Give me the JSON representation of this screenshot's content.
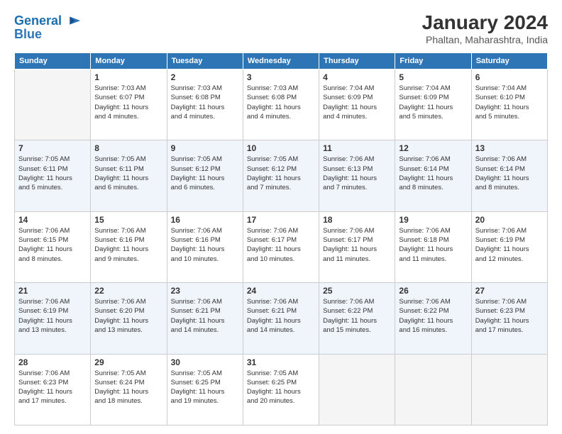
{
  "logo": {
    "line1": "General",
    "line2": "Blue"
  },
  "header": {
    "month": "January 2024",
    "location": "Phaltan, Maharashtra, India"
  },
  "weekdays": [
    "Sunday",
    "Monday",
    "Tuesday",
    "Wednesday",
    "Thursday",
    "Friday",
    "Saturday"
  ],
  "weeks": [
    [
      {
        "day": "",
        "info": ""
      },
      {
        "day": "1",
        "info": "Sunrise: 7:03 AM\nSunset: 6:07 PM\nDaylight: 11 hours\nand 4 minutes."
      },
      {
        "day": "2",
        "info": "Sunrise: 7:03 AM\nSunset: 6:08 PM\nDaylight: 11 hours\nand 4 minutes."
      },
      {
        "day": "3",
        "info": "Sunrise: 7:03 AM\nSunset: 6:08 PM\nDaylight: 11 hours\nand 4 minutes."
      },
      {
        "day": "4",
        "info": "Sunrise: 7:04 AM\nSunset: 6:09 PM\nDaylight: 11 hours\nand 4 minutes."
      },
      {
        "day": "5",
        "info": "Sunrise: 7:04 AM\nSunset: 6:09 PM\nDaylight: 11 hours\nand 5 minutes."
      },
      {
        "day": "6",
        "info": "Sunrise: 7:04 AM\nSunset: 6:10 PM\nDaylight: 11 hours\nand 5 minutes."
      }
    ],
    [
      {
        "day": "7",
        "info": "Sunrise: 7:05 AM\nSunset: 6:11 PM\nDaylight: 11 hours\nand 5 minutes."
      },
      {
        "day": "8",
        "info": "Sunrise: 7:05 AM\nSunset: 6:11 PM\nDaylight: 11 hours\nand 6 minutes."
      },
      {
        "day": "9",
        "info": "Sunrise: 7:05 AM\nSunset: 6:12 PM\nDaylight: 11 hours\nand 6 minutes."
      },
      {
        "day": "10",
        "info": "Sunrise: 7:05 AM\nSunset: 6:12 PM\nDaylight: 11 hours\nand 7 minutes."
      },
      {
        "day": "11",
        "info": "Sunrise: 7:06 AM\nSunset: 6:13 PM\nDaylight: 11 hours\nand 7 minutes."
      },
      {
        "day": "12",
        "info": "Sunrise: 7:06 AM\nSunset: 6:14 PM\nDaylight: 11 hours\nand 8 minutes."
      },
      {
        "day": "13",
        "info": "Sunrise: 7:06 AM\nSunset: 6:14 PM\nDaylight: 11 hours\nand 8 minutes."
      }
    ],
    [
      {
        "day": "14",
        "info": "Sunrise: 7:06 AM\nSunset: 6:15 PM\nDaylight: 11 hours\nand 8 minutes."
      },
      {
        "day": "15",
        "info": "Sunrise: 7:06 AM\nSunset: 6:16 PM\nDaylight: 11 hours\nand 9 minutes."
      },
      {
        "day": "16",
        "info": "Sunrise: 7:06 AM\nSunset: 6:16 PM\nDaylight: 11 hours\nand 10 minutes."
      },
      {
        "day": "17",
        "info": "Sunrise: 7:06 AM\nSunset: 6:17 PM\nDaylight: 11 hours\nand 10 minutes."
      },
      {
        "day": "18",
        "info": "Sunrise: 7:06 AM\nSunset: 6:17 PM\nDaylight: 11 hours\nand 11 minutes."
      },
      {
        "day": "19",
        "info": "Sunrise: 7:06 AM\nSunset: 6:18 PM\nDaylight: 11 hours\nand 11 minutes."
      },
      {
        "day": "20",
        "info": "Sunrise: 7:06 AM\nSunset: 6:19 PM\nDaylight: 11 hours\nand 12 minutes."
      }
    ],
    [
      {
        "day": "21",
        "info": "Sunrise: 7:06 AM\nSunset: 6:19 PM\nDaylight: 11 hours\nand 13 minutes."
      },
      {
        "day": "22",
        "info": "Sunrise: 7:06 AM\nSunset: 6:20 PM\nDaylight: 11 hours\nand 13 minutes."
      },
      {
        "day": "23",
        "info": "Sunrise: 7:06 AM\nSunset: 6:21 PM\nDaylight: 11 hours\nand 14 minutes."
      },
      {
        "day": "24",
        "info": "Sunrise: 7:06 AM\nSunset: 6:21 PM\nDaylight: 11 hours\nand 14 minutes."
      },
      {
        "day": "25",
        "info": "Sunrise: 7:06 AM\nSunset: 6:22 PM\nDaylight: 11 hours\nand 15 minutes."
      },
      {
        "day": "26",
        "info": "Sunrise: 7:06 AM\nSunset: 6:22 PM\nDaylight: 11 hours\nand 16 minutes."
      },
      {
        "day": "27",
        "info": "Sunrise: 7:06 AM\nSunset: 6:23 PM\nDaylight: 11 hours\nand 17 minutes."
      }
    ],
    [
      {
        "day": "28",
        "info": "Sunrise: 7:06 AM\nSunset: 6:23 PM\nDaylight: 11 hours\nand 17 minutes."
      },
      {
        "day": "29",
        "info": "Sunrise: 7:05 AM\nSunset: 6:24 PM\nDaylight: 11 hours\nand 18 minutes."
      },
      {
        "day": "30",
        "info": "Sunrise: 7:05 AM\nSunset: 6:25 PM\nDaylight: 11 hours\nand 19 minutes."
      },
      {
        "day": "31",
        "info": "Sunrise: 7:05 AM\nSunset: 6:25 PM\nDaylight: 11 hours\nand 20 minutes."
      },
      {
        "day": "",
        "info": ""
      },
      {
        "day": "",
        "info": ""
      },
      {
        "day": "",
        "info": ""
      }
    ]
  ]
}
